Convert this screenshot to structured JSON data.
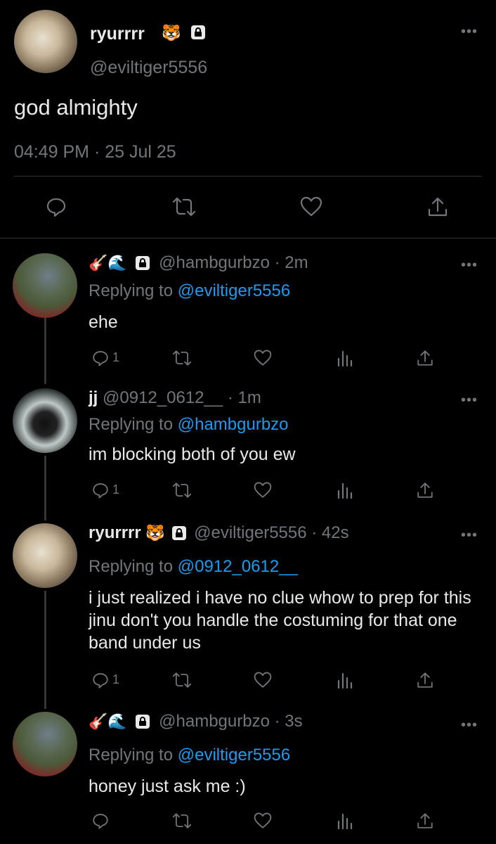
{
  "main_tweet": {
    "display_name": "ryurrrr",
    "name_emoji": "🐯",
    "handle": "@eviltiger5556",
    "text": "god almighty",
    "timestamp": "04:49 PM · 25 Jul 25"
  },
  "replies": [
    {
      "emojis": "🎸🌊",
      "display_name": "",
      "handle": "@hambgurbzo",
      "time": "· 2m",
      "replying_prefix": "Replying to",
      "replying_to": "@eviltiger5556",
      "text": "ehe",
      "reply_count": "1"
    },
    {
      "emojis": "",
      "display_name": "jj",
      "handle": "@0912_0612__",
      "time": "· 1m",
      "replying_prefix": "Replying to",
      "replying_to": "@hambgurbzo",
      "text": "im blocking both of you ew",
      "reply_count": "1"
    },
    {
      "emojis": "🐯",
      "display_name": "ryurrrr",
      "handle": "@eviltiger5556",
      "time": "· 42s",
      "replying_prefix": "Replying to",
      "replying_to": "@0912_0612__",
      "text": "i just realized i have no clue whow to prep for this jinu don't you handle the costuming for that one band under us",
      "reply_count": "1"
    },
    {
      "emojis": "🎸🌊",
      "display_name": "",
      "handle": "@hambgurbzo",
      "time": "· 3s",
      "replying_prefix": "Replying to",
      "replying_to": "@eviltiger5556",
      "text": "honey just ask me :)",
      "reply_count": ""
    }
  ],
  "icons": {
    "lock": "lock-icon",
    "more": "more-icon",
    "reply": "reply-icon",
    "retweet": "retweet-icon",
    "like": "heart-icon",
    "views": "views-icon",
    "share": "share-icon"
  },
  "colors": {
    "background": "#000000",
    "text": "#e7e9ea",
    "muted": "#71767b",
    "link": "#1d9bf0"
  }
}
